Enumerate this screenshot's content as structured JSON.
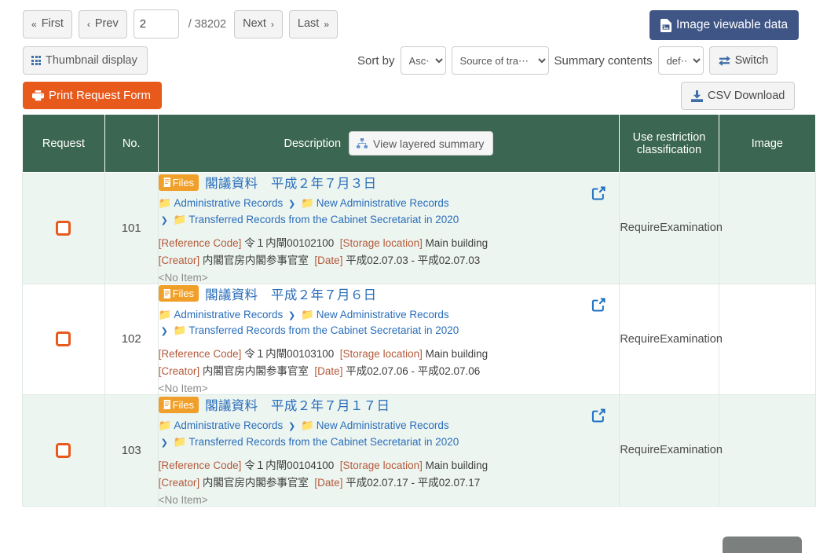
{
  "toolbar": {
    "first_label": "First",
    "prev_label": "Prev",
    "next_label": "Next",
    "last_label": "Last",
    "page_value": "2",
    "page_total": "/ 38202",
    "thumbnail_label": "Thumbnail display",
    "print_label": "Print Request Form",
    "image_data_label": "Image viewable data",
    "sort_by_label": "Sort by",
    "sort_order_value": "Asc⋯",
    "sort_field_value": "Source of tra⋯",
    "summary_contents_label": "Summary contents",
    "summary_contents_value": "def⋯",
    "switch_label": "Switch",
    "csv_label": "CSV Download",
    "accent_orange": "#e8591c",
    "accent_navy": "#3e5585",
    "header_green": "#3b6651"
  },
  "table": {
    "headers": {
      "request": "Request",
      "no": "No.",
      "description": "Description",
      "layered_summary": "View layered summary",
      "use_restriction": "Use restriction classification",
      "image": "Image"
    },
    "rows": [
      {
        "no": "101",
        "badge": "Files",
        "title": "閣議資料　平成２年７月３日",
        "crumbs": [
          "Administrative Records",
          "New Administrative Records",
          "Transferred Records from the Cabinet Secretariat in 2020"
        ],
        "reference_code_key": "[Reference Code]",
        "reference_code": "令１内閘00102100",
        "storage_key": "[Storage location]",
        "storage": "Main building",
        "creator_key": "[Creator]",
        "creator": "内閣官房内閣参事官室",
        "date_key": "[Date]",
        "date": "平成02.07.03 - 平成02.07.03",
        "no_item": "<No Item>",
        "use_restriction": "RequireExamination"
      },
      {
        "no": "102",
        "badge": "Files",
        "title": "閣議資料　平成２年７月６日",
        "crumbs": [
          "Administrative Records",
          "New Administrative Records",
          "Transferred Records from the Cabinet Secretariat in 2020"
        ],
        "reference_code_key": "[Reference Code]",
        "reference_code": "令１内閘00103100",
        "storage_key": "[Storage location]",
        "storage": "Main building",
        "creator_key": "[Creator]",
        "creator": "内閣官房内閣参事官室",
        "date_key": "[Date]",
        "date": "平成02.07.06 - 平成02.07.06",
        "no_item": "<No Item>",
        "use_restriction": "RequireExamination"
      },
      {
        "no": "103",
        "badge": "Files",
        "title": "閣議資料　平成２年７月１７日",
        "crumbs": [
          "Administrative Records",
          "New Administrative Records",
          "Transferred Records from the Cabinet Secretariat in 2020"
        ],
        "reference_code_key": "[Reference Code]",
        "reference_code": "令１内閘00104100",
        "storage_key": "[Storage location]",
        "storage": "Main building",
        "creator_key": "[Creator]",
        "creator": "内閣官房内閣参事官室",
        "date_key": "[Date]",
        "date": "平成02.07.17 - 平成02.07.17",
        "no_item": "<No Item>",
        "use_restriction": "RequireExamination"
      }
    ]
  },
  "icons": {
    "first": "double-chevron-left-icon",
    "prev": "chevron-left-icon",
    "next": "chevron-right-icon",
    "last": "double-chevron-right-icon",
    "thumbnail": "grid-icon",
    "print": "printer-icon",
    "image_data": "file-image-icon",
    "switch": "exchange-arrows-icon",
    "csv": "download-icon",
    "layered": "sitemap-icon",
    "files_badge": "book-icon",
    "folder": "folder-open-icon",
    "external": "external-link-icon"
  }
}
